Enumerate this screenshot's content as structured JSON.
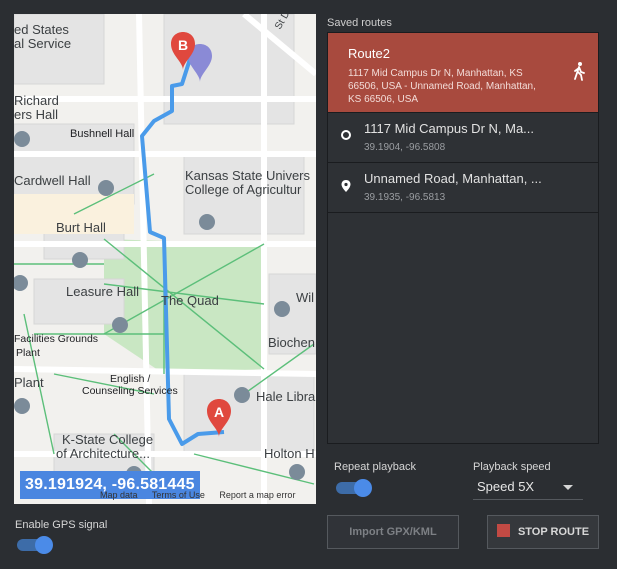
{
  "map": {
    "coordinate_readout": "39.191924, -96.581445",
    "labels": {
      "united_states_postal": "ed States",
      "postal_service": "al Service",
      "richard": "Richard",
      "ers_hall": "ers Hall",
      "bushnell_hall": "Bushnell Hall",
      "cardwell_hall": "Cardwell Hall",
      "ksu_line1": "Kansas State Univers",
      "ksu_line2": "College of Agricultur",
      "burt_hall": "Burt Hall",
      "leasure_hall": "Leasure Hall",
      "the_quad": "The Quad",
      "wil": "Wil",
      "facilities_line1": "Facilities Grounds",
      "facilities_line2": "Plant",
      "plant": "Plant",
      "english_line1": "English /",
      "english_line2": "Counseling Services",
      "hale": "Hale Libra",
      "biochem": "Biochen",
      "kstate_line1": "K-State College",
      "kstate_line2": "of Architecture...",
      "holton": "Holton H",
      "st_dr": "St Dr"
    },
    "marker_a": "A",
    "marker_b": "B",
    "footer": {
      "map_data": "Map data",
      "terms": "Terms of Use",
      "report": "Report a map error"
    }
  },
  "gps": {
    "label": "Enable GPS signal",
    "enabled": true
  },
  "routes_panel": {
    "label": "Saved routes",
    "active_route": {
      "name": "Route2",
      "address": "1117 Mid Campus Dr N, Manhattan, KS 66506, USA - Unnamed Road, Manhattan, KS 66506, USA",
      "icon": "walking-person-icon"
    },
    "items": [
      {
        "title": "1117 Mid Campus Dr N, Ma...",
        "coords": "39.1904, -96.5808",
        "icon": "circle-icon"
      },
      {
        "title": "Unnamed Road, Manhattan, ...",
        "coords": "39.1935, -96.5813",
        "icon": "location-pin-icon"
      }
    ]
  },
  "playback": {
    "repeat_label": "Repeat playback",
    "repeat_enabled": true,
    "speed_label": "Playback speed",
    "speed_value": "Speed 5X"
  },
  "buttons": {
    "import": "Import GPX/KML",
    "stop": "STOP ROUTE"
  },
  "colors": {
    "background": "#2b2e32",
    "active_route": "#a84a3e",
    "route_line": "#4a9bea",
    "toggle_on": "#4b8be8",
    "stop_icon": "#c24a44"
  }
}
